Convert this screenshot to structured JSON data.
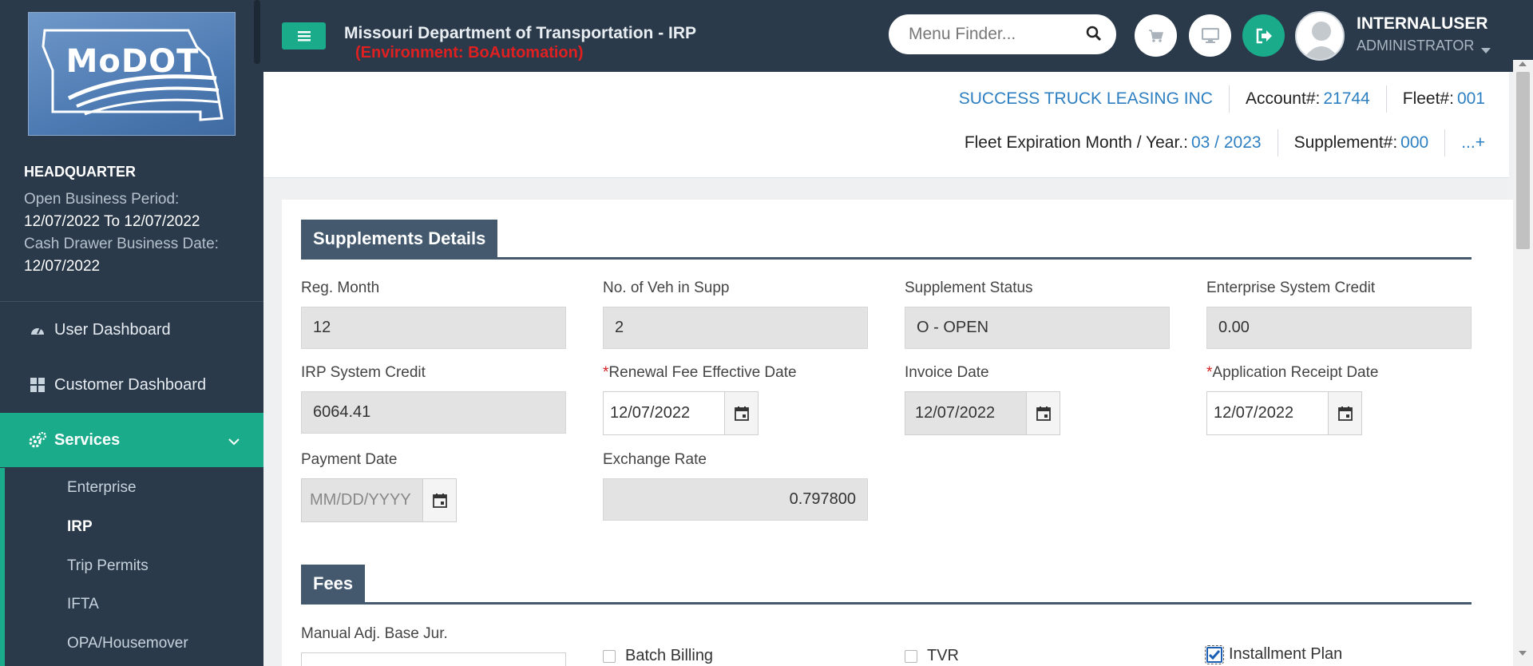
{
  "sidebar": {
    "logo_text": "MoDOT",
    "office": "HEADQUARTER",
    "open_period_label": "Open Business Period:",
    "open_period_value": "12/07/2022 To 12/07/2022",
    "cash_drawer_label": "Cash Drawer Business Date:",
    "cash_drawer_value": "12/07/2022",
    "nav": [
      {
        "label": "User Dashboard",
        "icon": "dashboard-icon"
      },
      {
        "label": "Customer Dashboard",
        "icon": "grid-icon"
      },
      {
        "label": "Services",
        "icon": "gears-icon"
      }
    ],
    "sub_items": [
      "Enterprise",
      "IRP",
      "Trip Permits",
      "IFTA",
      "OPA/Housemover"
    ]
  },
  "header": {
    "title": "Missouri Department of Transportation - IRP",
    "environment": "(Environment: BoAutomation)",
    "menu_finder_placeholder": "Menu Finder...",
    "user_name": "INTERNALUSER",
    "user_role": "ADMINISTRATOR"
  },
  "info": {
    "company": "SUCCESS TRUCK LEASING INC",
    "account_label": "Account#:",
    "account": "21744",
    "fleet_label": "Fleet#:",
    "fleet": "001",
    "expiration_label": "Fleet Expiration Month / Year.:",
    "expiration": "03 / 2023",
    "supplement_label": "Supplement#:",
    "supplement": "000",
    "more": "...+"
  },
  "supplements": {
    "heading": "Supplements Details",
    "reg_month_label": "Reg. Month",
    "reg_month": "12",
    "veh_label": "No. of Veh in Supp",
    "veh": "2",
    "status_label": "Supplement Status",
    "status": "O - OPEN",
    "ent_credit_label": "Enterprise System Credit",
    "ent_credit": "0.00",
    "irp_credit_label": "IRP System Credit",
    "irp_credit": "6064.41",
    "renewal_label": "Renewal Fee Effective Date",
    "renewal": "12/07/2022",
    "invoice_label": "Invoice Date",
    "invoice": "12/07/2022",
    "receipt_label": "Application Receipt Date",
    "receipt": "12/07/2022",
    "payment_label": "Payment Date",
    "payment_placeholder": "MM/DD/YYYY",
    "exchange_label": "Exchange Rate",
    "exchange": "0.797800",
    "required_mark": "*"
  },
  "fees": {
    "heading": "Fees",
    "manual_adj_label": "Manual Adj. Base Jur.",
    "batch_billing": "Batch Billing",
    "tvr": "TVR",
    "installment_plan": "Installment Plan",
    "installment_checked": true
  }
}
